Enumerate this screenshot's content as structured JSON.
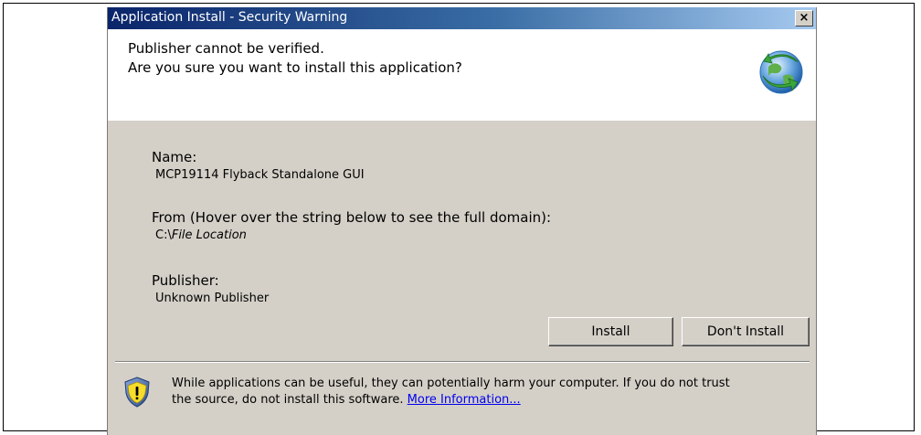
{
  "dialog": {
    "title": "Application Install - Security Warning",
    "close_label": "×"
  },
  "header": {
    "line1": "Publisher cannot be verified.",
    "line2": "Are you sure you want to install this application?"
  },
  "fields": {
    "name_label": "Name:",
    "name_value": "MCP19114 Flyback Standalone GUI",
    "from_label": "From (Hover over the string below to see the full domain):",
    "from_prefix": "C:\\",
    "from_value": "File Location",
    "publisher_label": "Publisher:",
    "publisher_value": "Unknown Publisher"
  },
  "buttons": {
    "install": "Install",
    "dont_install": "Don't Install"
  },
  "warning": {
    "line1": "While applications can be useful, they can potentially harm your computer. If you do not trust",
    "line2": "the source, do not install this software. ",
    "link": "More Information..."
  },
  "icons": {
    "globe": "globe-arrow-icon",
    "shield": "security-shield-icon"
  },
  "colors": {
    "title_bar_start": "#0a246a",
    "title_bar_end": "#a6caf0",
    "dialog_bg": "#d4d0c8",
    "link": "#0000ee"
  }
}
